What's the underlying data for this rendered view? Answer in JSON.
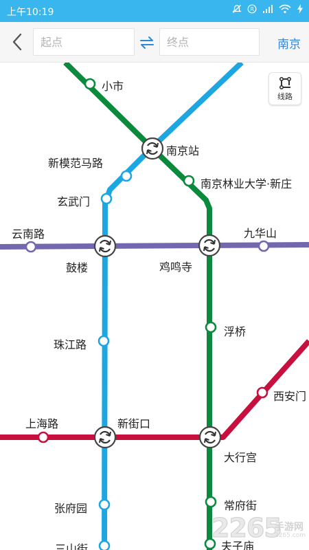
{
  "status": {
    "time": "上午10:19",
    "icons": [
      "mute-icon",
      "r-icon",
      "signal-icon",
      "wifi-icon",
      "charging-icon"
    ]
  },
  "header": {
    "start_placeholder": "起点",
    "end_placeholder": "终点",
    "city": "南京"
  },
  "map": {
    "lines_button": "线路",
    "colors": {
      "line1": "#1ea6e0",
      "line3": "#0b8a3e",
      "line2": "#c8103e",
      "line4": "#7367b0"
    },
    "stations": {
      "xiaoshi": "小市",
      "nanjing_station": "南京站",
      "xinmofanmalu": "新模范马路",
      "njfu": "南京林业大学·新庄",
      "xuanwumen": "玄武门",
      "yunnanlu": "云南路",
      "gulou": "鼓楼",
      "jimingsi": "鸡鸣寺",
      "jiuhuashan": "九华山",
      "fuqiao": "浮桥",
      "zhujianglu": "珠江路",
      "xi_anmen": "西安门",
      "shanghailu": "上海路",
      "xinjiekou": "新街口",
      "daxinggong": "大行宫",
      "changfujie": "常府街",
      "zhangfuyuan": "张府园",
      "sanshanjie": "三山街",
      "fuzimiao": "夫子庙"
    }
  },
  "watermark": {
    "number": "2265",
    "sub": "手游网",
    "url": "2265.com"
  }
}
